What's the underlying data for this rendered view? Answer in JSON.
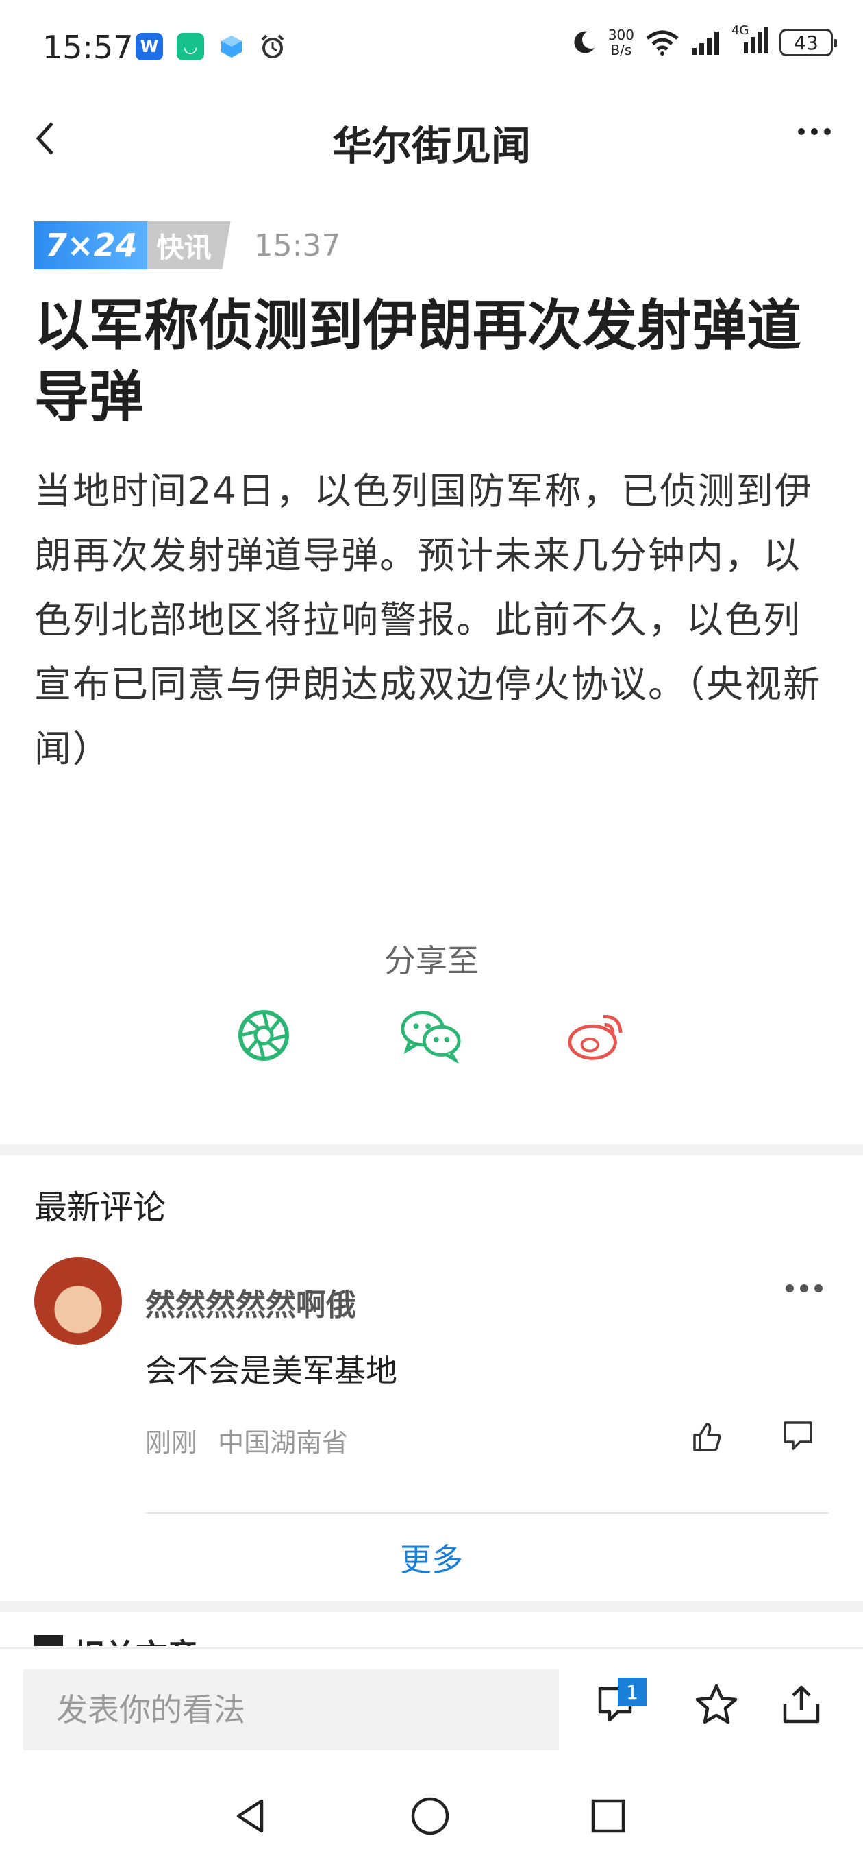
{
  "status_bar": {
    "time": "15:57",
    "net_speed_value": "300",
    "net_speed_unit": "B/s",
    "network_label": "4G",
    "battery": "43",
    "app_icons": [
      "w-app-icon",
      "green-app-icon",
      "blue-cube-icon",
      "alarm-icon"
    ]
  },
  "header": {
    "title": "华尔街见闻"
  },
  "article": {
    "tag_number": "7×24",
    "tag_word": "快讯",
    "time": "15:37",
    "headline": "以军称侦测到伊朗再次发射弹道导弹",
    "body": "当地时间24日，以色列国防军称，已侦测到伊朗再次发射弹道导弹。预计未来几分钟内，以色列北部地区将拉响警报。此前不久，以色列宣布已同意与伊朗达成双边停火协议。（央视新闻）"
  },
  "share": {
    "label": "分享至",
    "targets": [
      "moments-icon",
      "wechat-icon",
      "weibo-icon"
    ]
  },
  "comments": {
    "section_title": "最新评论",
    "items": [
      {
        "username": "然然然然然啊俄",
        "text": "会不会是美军基地",
        "time": "刚刚",
        "location": "中国湖南省"
      }
    ],
    "more_label": "更多"
  },
  "related": {
    "title": "相关文章"
  },
  "bottom_bar": {
    "input_placeholder": "发表你的看法",
    "comment_count": "1"
  },
  "colors": {
    "accent_blue": "#1a7fd9",
    "share_green": "#2bb673",
    "weibo_red": "#e8554e"
  }
}
